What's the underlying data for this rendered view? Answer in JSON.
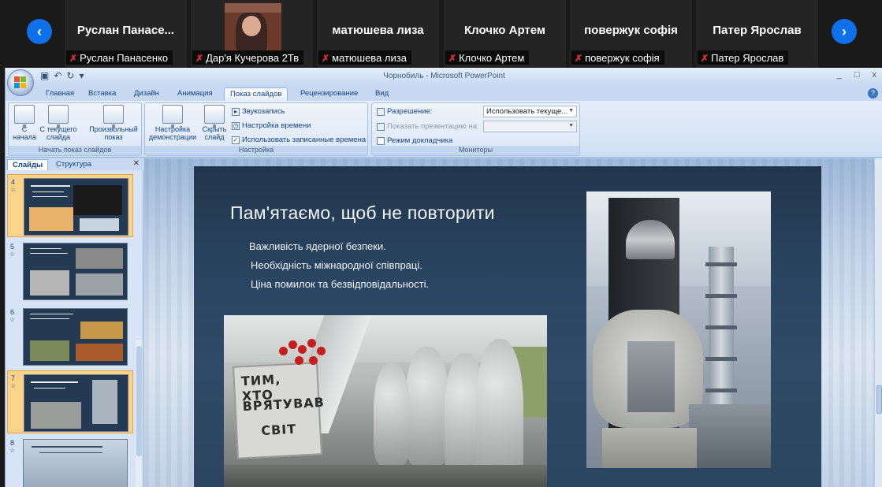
{
  "participants": {
    "tiles": [
      {
        "name": "Руслан  Панасе...",
        "label": "Руслан Панасенко"
      },
      {
        "name": "",
        "label": "Дар'я Кучерова 2Тв"
      },
      {
        "name": "матюшева лиза",
        "label": "матюшева лиза"
      },
      {
        "name": "Клочко Артем",
        "label": "Клочко Артем"
      },
      {
        "name": "повержук софія",
        "label": "повержук софія"
      },
      {
        "name": "Патер Ярослав",
        "label": "Патер Ярослав"
      }
    ],
    "accent": "#0e71eb",
    "mic_off_color": "#e0322d"
  },
  "window": {
    "title": "Чорнобиль - Microsoft PowerPoint",
    "controls": [
      "_",
      "□",
      "x"
    ]
  },
  "ribbon": {
    "tabs": [
      "Главная",
      "Вставка",
      "Дизайн",
      "Анимация",
      "Показ слайдов",
      "Рецензирование",
      "Вид"
    ],
    "active_tab": "Показ слайдов",
    "groups": {
      "start": {
        "label": "Начать показ слайдов",
        "from_start": "С начала",
        "from_current": "С текущего слайда",
        "custom": "Произвольный показ"
      },
      "setup": {
        "label": "Настройка",
        "setup_show": "Настройка демонстрации",
        "hide_slide": "Скрыть слайд",
        "record_narration": "Звукозапись",
        "rehearse_timings": "Настройка времени",
        "use_timings": "Использовать записанные времена"
      },
      "monitors": {
        "label": "Мониторы",
        "resolution_label": "Разрешение:",
        "resolution_value": "Использовать текуще...",
        "show_on_label": "Показать презентацию на:",
        "presenter_view": "Режим докладчика"
      }
    }
  },
  "slide_panel": {
    "tabs": [
      "Слайды",
      "Структура"
    ],
    "active_tab": "Слайды",
    "items": [
      {
        "number": "4",
        "selected": false
      },
      {
        "number": "5",
        "selected": false
      },
      {
        "number": "6",
        "selected": false
      },
      {
        "number": "7",
        "selected": true
      },
      {
        "number": "8",
        "selected": false
      }
    ]
  },
  "slide": {
    "title": "Пам'ятаємо, щоб не повторити",
    "bullets": [
      "Важливість ядерної безпеки.",
      "Необхідність міжнародної співпраці.",
      "Ціна помилок та безвідповідальності."
    ],
    "plaque_lines": [
      "ТИМ, ХТО",
      "ВРЯТУВАВ",
      "СВІТ"
    ]
  }
}
